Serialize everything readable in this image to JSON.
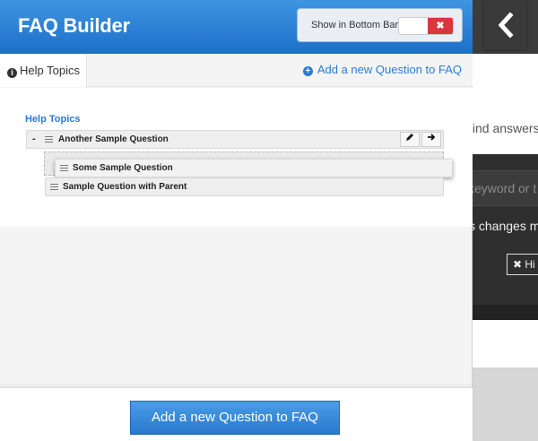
{
  "app": {
    "title": "FAQ Builder",
    "toggle": {
      "label": "Show in Bottom Bar",
      "state_icon": "✖",
      "state": "off"
    }
  },
  "tabs": {
    "active": "Help Topics",
    "add_link": "Add a new Question to FAQ"
  },
  "tree": {
    "heading": "Help Topics",
    "rows": [
      {
        "label": "Another Sample Question",
        "collapse": "-"
      },
      {
        "label": "Some Sample Question"
      },
      {
        "label": "Sample Question with Parent"
      }
    ]
  },
  "footer": {
    "add_button": "Add a new Question to FAQ"
  },
  "background": {
    "back_icon": "chevron-left",
    "text1": "find answers",
    "search_placeholder": "keyword or t",
    "text2": "s changes ma",
    "hide_label": "✖ Hi"
  },
  "colors": {
    "accent": "#2a7bd6",
    "header_top": "#3f95e0",
    "header_bottom": "#1d6fc9",
    "danger": "#d9363e"
  }
}
